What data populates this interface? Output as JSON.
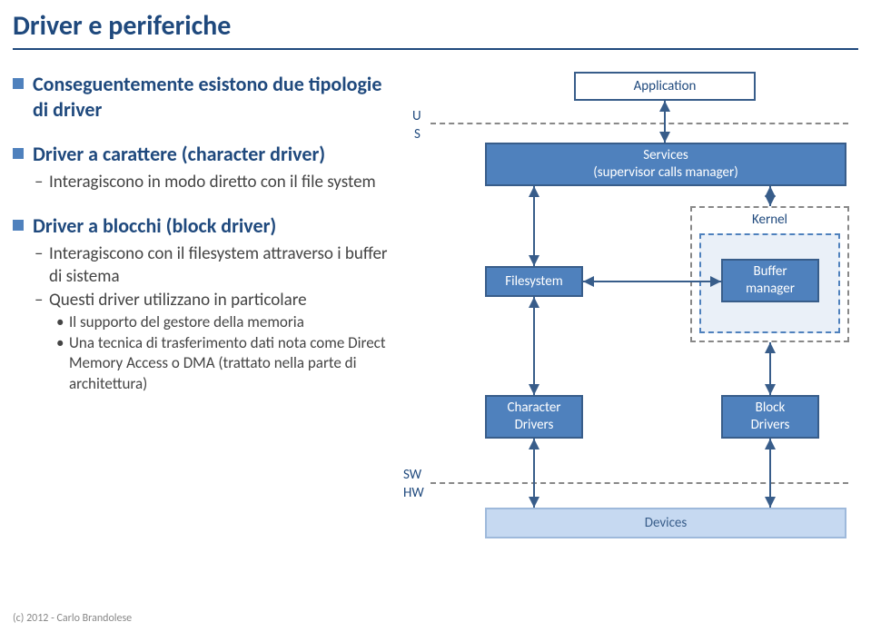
{
  "title": "Driver e periferiche",
  "b1": "Conseguentemente esistono due tipologie di driver",
  "b2": "Driver a carattere (character driver)",
  "b2s1": "Interagiscono in modo diretto con il file system",
  "b3": "Driver a blocchi (block driver)",
  "b3s1": "Interagiscono con il filesystem attraverso i buffer di sistema",
  "b3s2": "Questi driver utilizzano in particolare",
  "b3ss1": "Il supporto del gestore della memoria",
  "b3ss2": "Una tecnica di trasferimento dati nota come Direct Memory Access o DMA (trattato nella parte di architettura)",
  "diagram": {
    "u": "U",
    "s": "S",
    "sw": "SW",
    "hw": "HW",
    "app": "Application",
    "services": "Services\n(supervisor calls manager)",
    "kernel": "Kernel",
    "fs": "Filesystem",
    "buf": "Buffer\nmanager",
    "char": "Character\nDrivers",
    "block": "Block\nDrivers",
    "dev": "Devices"
  },
  "footer": "(c) 2012 - Carlo Brandolese"
}
